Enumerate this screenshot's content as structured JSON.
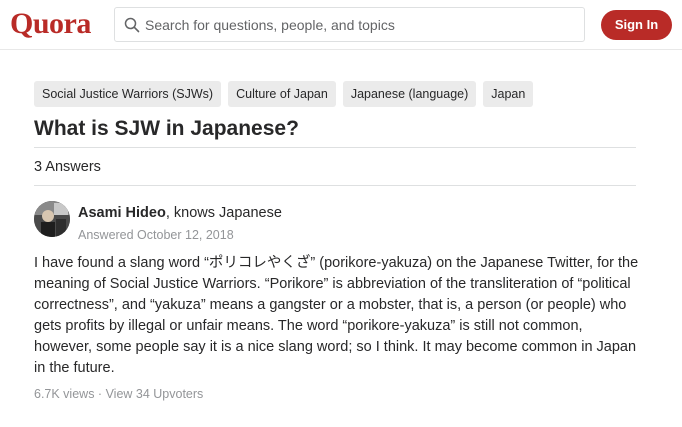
{
  "brand": {
    "logo": "Quora",
    "accent": "#b92b27"
  },
  "search": {
    "placeholder": "Search for questions, people, and topics",
    "icon": "search-icon"
  },
  "header": {
    "signin_label": "Sign In"
  },
  "topics": [
    "Social Justice Warriors (SJWs)",
    "Culture of Japan",
    "Japanese (language)",
    "Japan"
  ],
  "question": {
    "title": "What is SJW in Japanese?",
    "answers_count": "3 Answers"
  },
  "answer": {
    "author_name": "Asami Hideo",
    "author_credential": ", knows Japanese",
    "date": "Answered October 12, 2018",
    "text": "I have found a slang word “ポリコレやくざ” (porikore-yakuza) on the Japanese Twitter, for the meaning of Social Justice Warriors. “Porikore” is abbreviation of the transliteration of “political correctness”, and “yakuza” means a gangster or a mobster, that is, a person (or people) who gets profits by illegal or unfair means. The word “porikore-yakuza” is still not common, however, some people say it is a nice slang word; so I think. It may become common in Japan in the future.",
    "views": "6.7K views",
    "separator": " · ",
    "upvoters": "View 34 Upvoters"
  }
}
